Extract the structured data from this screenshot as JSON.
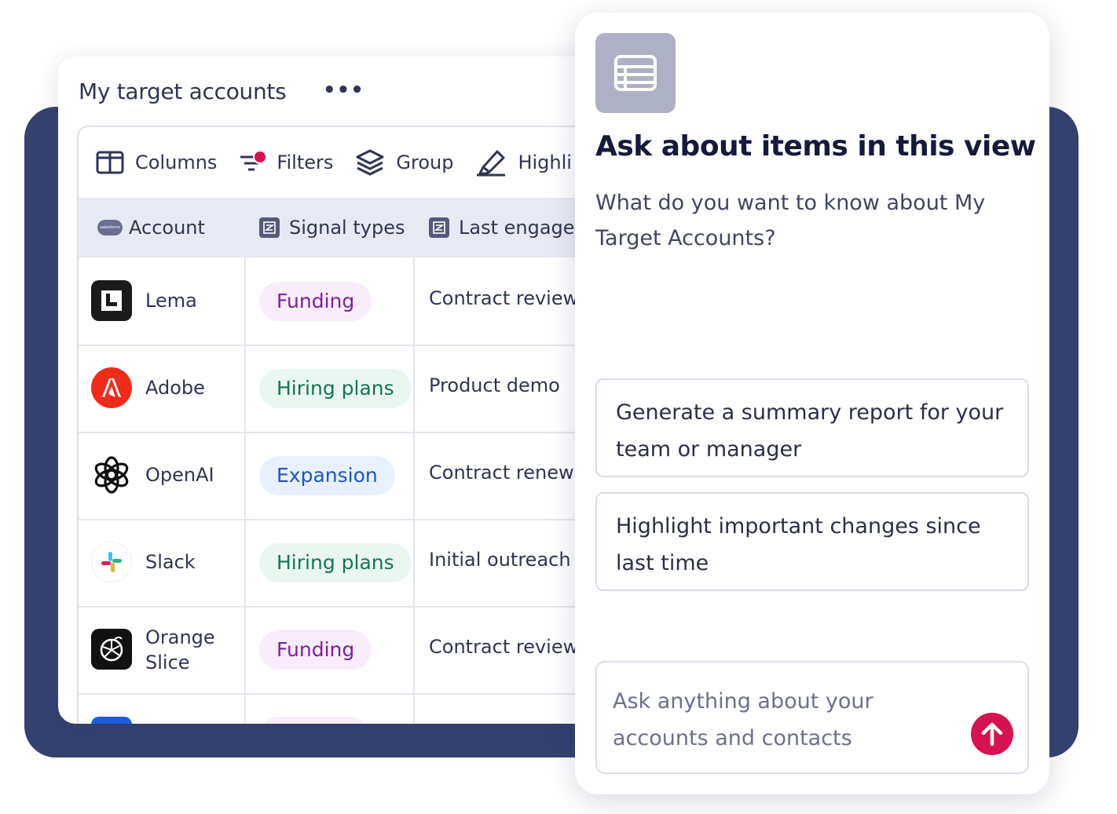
{
  "accounts_card": {
    "title": "My target accounts",
    "more_label": "•••",
    "toolbar": {
      "columns": "Columns",
      "filters": "Filters",
      "group": "Group",
      "highlight": "Highli"
    },
    "headers": {
      "account": "Account",
      "salesforce_badge": "salesforce",
      "signal_types": "Signal types",
      "last_engagement": "Last engage"
    },
    "rows": [
      {
        "name": "Lema",
        "signal": "Funding",
        "engagement": "Contract review"
      },
      {
        "name": "Adobe",
        "signal": "Hiring plans",
        "engagement": "Product demo"
      },
      {
        "name": "OpenAI",
        "signal": "Expansion",
        "engagement": "Contract renewa"
      },
      {
        "name": "Slack",
        "signal": "Hiring plans",
        "engagement": "Initial outreach"
      },
      {
        "name_line1": "Orange",
        "name_line2": "Slice",
        "signal": "Funding",
        "engagement": "Contract review"
      }
    ]
  },
  "ask_panel": {
    "title": "Ask about items in this view",
    "subtitle": "What do you want to know about My Target Accounts?",
    "suggestions": [
      "Generate a summary report for your team or manager",
      "Highlight important changes since last time"
    ],
    "input_placeholder": "Ask anything about your accounts and contacts"
  },
  "colors": {
    "navy_background": "#364170",
    "send_button": "#d6124f",
    "funding_text": "#7d1fa0",
    "hiring_text": "#167553",
    "expansion_text": "#1c55c7"
  }
}
